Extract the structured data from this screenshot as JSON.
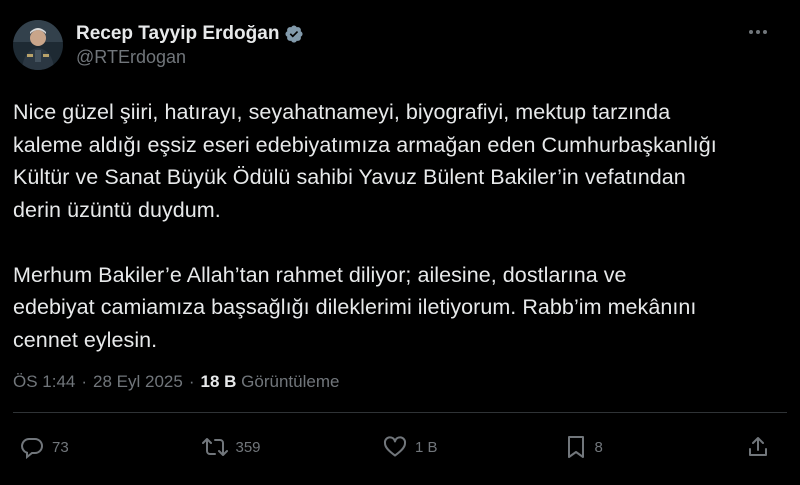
{
  "author": {
    "display_name": "Recep Tayyip Erdoğan",
    "handle": "@RTErdogan",
    "verified": true
  },
  "tweet": {
    "text": "Nice güzel şiiri, hatırayı, seyahatnameyi, biyografiyi, mektup tarzında\nkaleme aldığı eşsiz eseri edebiyatımıza armağan eden Cumhurbaşkanlığı\nKültür ve Sanat Büyük Ödülü sahibi Yavuz Bülent Bakiler’in vefatından\nderin üzüntü duydum.\n\nMerhum Bakiler’e Allah’tan rahmet diliyor; ailesine, dostlarına ve\nedebiyat camiamıza başsağlığı dileklerimi iletiyorum. Rabb’im mekânını\ncennet eylesin."
  },
  "meta": {
    "time": "ÖS 1:44",
    "separator": "·",
    "date": "28 Eyl 2025",
    "views_count": "18 B",
    "views_label": "Görüntüleme"
  },
  "actions": {
    "replies": "73",
    "reposts": "359",
    "likes": "1 B",
    "bookmarks": "8"
  },
  "icons": {
    "verified": "verified-badge-icon",
    "more": "more-icon",
    "reply": "reply-icon",
    "repost": "repost-icon",
    "like": "heart-icon",
    "bookmark": "bookmark-icon",
    "share": "share-icon"
  },
  "colors": {
    "background": "#000000",
    "text": "#e7e9ea",
    "muted": "#71767b",
    "divider": "#2f3336",
    "verified_badge": "#829aab"
  }
}
